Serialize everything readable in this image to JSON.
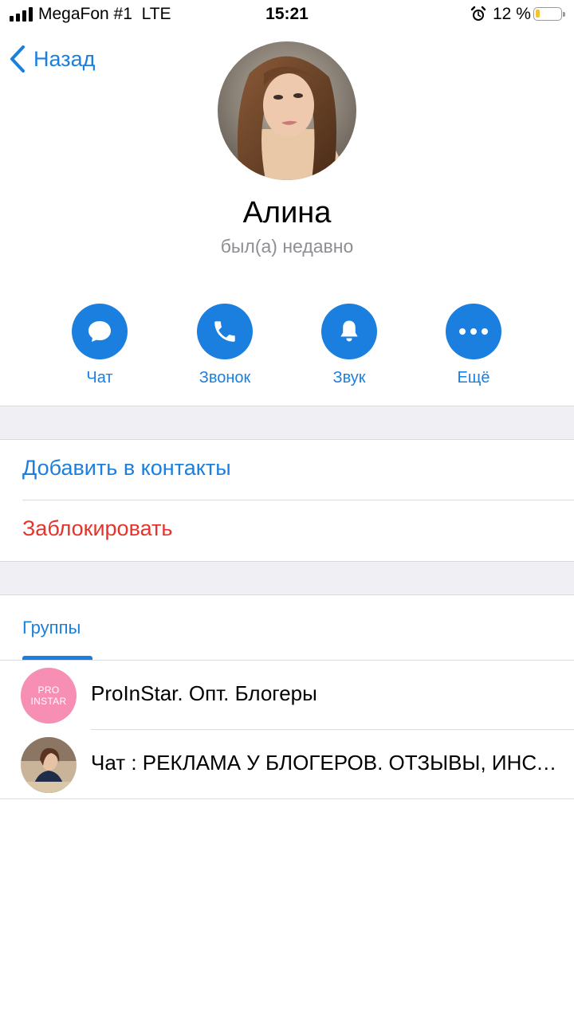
{
  "status_bar": {
    "carrier": "MegaFon #1",
    "network": "LTE",
    "time": "15:21",
    "battery_percent": "12 %",
    "battery_level": 0.12
  },
  "nav": {
    "back_label": "Назад"
  },
  "profile": {
    "name": "Алина",
    "status": "был(а) недавно"
  },
  "actions": [
    {
      "label": "Чат",
      "icon": "chat-bubble-icon"
    },
    {
      "label": "Звонок",
      "icon": "phone-icon"
    },
    {
      "label": "Звук",
      "icon": "bell-icon"
    },
    {
      "label": "Ещё",
      "icon": "more-dots-icon"
    }
  ],
  "menu": {
    "add_contact": "Добавить в контакты",
    "block": "Заблокировать"
  },
  "tabs": {
    "groups": "Группы"
  },
  "groups": [
    {
      "title": "ProInStar. Опт. Блогеры",
      "avatar_text_1": "PRO",
      "avatar_text_2": "INSTAR"
    },
    {
      "title": "Чат : РЕКЛАМА У БЛОГЕРОВ. ОТЗЫВЫ, ИНСТАГРАМ"
    }
  ],
  "colors": {
    "accent": "#1a7fdf",
    "danger": "#e5342b",
    "secondary_text": "#8e8e93",
    "section_background": "#efeff4",
    "pro_avatar": "#f68fb3"
  }
}
